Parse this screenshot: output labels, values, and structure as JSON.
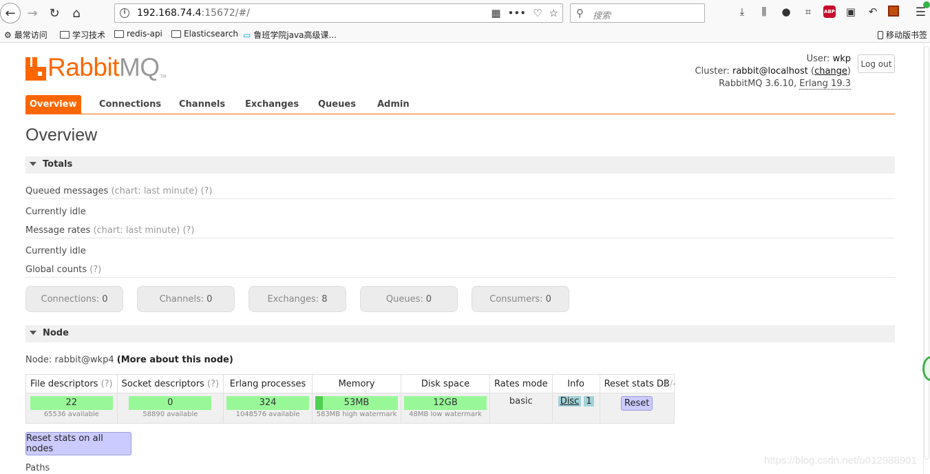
{
  "browser": {
    "url_host": "192.168.74.4",
    "url_rest": ":15672/#/",
    "search_placeholder": "搜索",
    "bookmarks": [
      "最常访问",
      "学习技术",
      "redis-api",
      "Elasticsearch",
      "鲁班学院java高级课..."
    ],
    "mobile_bookmarks": "移动版书签",
    "abp_label": "ABP"
  },
  "header": {
    "logo_rabbit": "Rabbit",
    "logo_mq": "MQ",
    "logo_tm": "TM",
    "user_label": "User:",
    "user": "wkp",
    "cluster_label": "Cluster:",
    "cluster": "rabbit@localhost",
    "change": "change",
    "version": "RabbitMQ 3.6.10,",
    "erlang": "Erlang 19.3",
    "logout": "Log out"
  },
  "tabs": [
    "Overview",
    "Connections",
    "Channels",
    "Exchanges",
    "Queues",
    "Admin"
  ],
  "page_title": "Overview",
  "totals": {
    "heading": "Totals",
    "queued": "Queued messages",
    "queued_hint": "(chart: last minute) (?)",
    "idle1": "Currently idle",
    "rates": "Message rates",
    "rates_hint": "(chart: last minute) (?)",
    "idle2": "Currently idle",
    "global": "Global counts",
    "global_hint": "(?)",
    "counts": [
      {
        "label": "Connections:",
        "value": "0"
      },
      {
        "label": "Channels:",
        "value": "0"
      },
      {
        "label": "Exchanges:",
        "value": "8"
      },
      {
        "label": "Queues:",
        "value": "0"
      },
      {
        "label": "Consumers:",
        "value": "0"
      }
    ]
  },
  "node": {
    "heading": "Node",
    "node_label": "Node: rabbit@wkp4",
    "more": "(More about this node)",
    "columns": {
      "fd": "File descriptors",
      "fd_hint": "(?)",
      "sd": "Socket descriptors",
      "sd_hint": "(?)",
      "ep": "Erlang processes",
      "mem": "Memory",
      "disk": "Disk space",
      "rates": "Rates mode",
      "info": "Info",
      "reset": "Reset stats DB"
    },
    "plusminus": "+/-",
    "fd": {
      "value": "22",
      "sub": "65536 available"
    },
    "sd": {
      "value": "0",
      "sub": "58890 available"
    },
    "ep": {
      "value": "324",
      "sub": "1048576 available"
    },
    "mem": {
      "value": "53MB",
      "sub": "583MB high watermark",
      "fill": 0.09
    },
    "disk": {
      "value": "12GB",
      "sub": "48MB low watermark"
    },
    "rates_mode": "basic",
    "info_disc": "Disc",
    "info_count": "1",
    "reset_btn": "Reset",
    "reset_all": "Reset stats on all nodes",
    "paths": "Paths"
  },
  "watermark": "https://blog.csdn.net/u012988901"
}
